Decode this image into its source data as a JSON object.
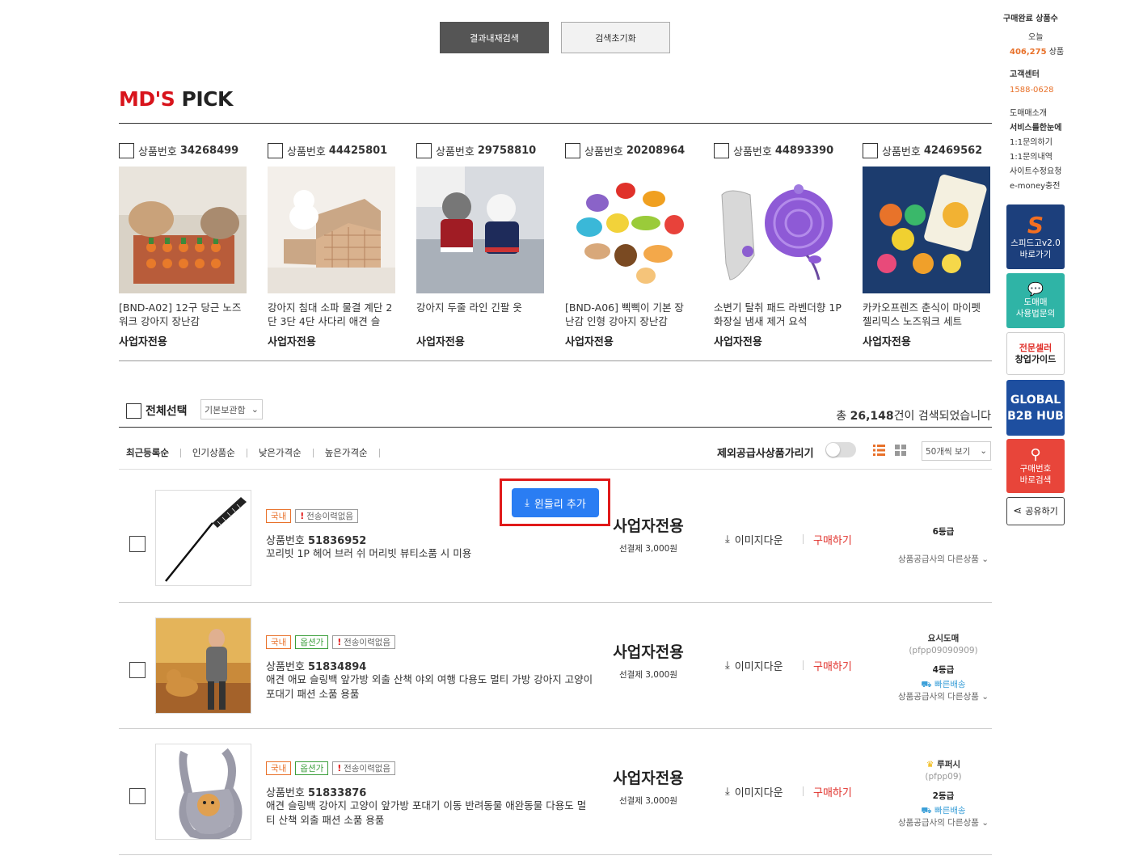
{
  "top_buttons": {
    "search_within": "결과내재검색",
    "reset_search": "검색초기화"
  },
  "md_pick": {
    "title_red": "MD'S",
    "title_black": "PICK",
    "items": [
      {
        "number_label": "상품번호",
        "number": "34268499",
        "name": "[BND-A02] 12구 당근 노즈워크 강아지 장난감",
        "tag": "사업자전용"
      },
      {
        "number_label": "상품번호",
        "number": "44425801",
        "name": "강아지 침대 소파 물결 계단 2단 3단 4단 사다리 애견 슬",
        "tag": "사업자전용"
      },
      {
        "number_label": "상품번호",
        "number": "29758810",
        "name": "강아지 두줄 라인 긴팔 옷",
        "tag": "사업자전용"
      },
      {
        "number_label": "상품번호",
        "number": "20208964",
        "name": "[BND-A06] 삑삑이 기본 장난감 인형 강아지 장난감",
        "tag": "사업자전용"
      },
      {
        "number_label": "상품번호",
        "number": "44893390",
        "name": "소변기 탈취 패드 라벤더향 1P 화장실 냄새 제거 요석",
        "tag": "사업자전용"
      },
      {
        "number_label": "상품번호",
        "number": "42469562",
        "name": "카카오프렌즈 춘식이 마이펫 젤리믹스 노즈워크 세트",
        "tag": "사업자전용"
      }
    ]
  },
  "list_header": {
    "select_all": "전체선택",
    "storage_select": "기본보관함",
    "total_prefix": "총",
    "total_count": "26,148",
    "total_suffix": "건이 검색되었습니다",
    "sort_options": [
      "최근등록순",
      "인기상품순",
      "낮은가격순",
      "높은가격순"
    ],
    "exclude_label": "제외공급사상품가리기",
    "per_page": "50개씩 보기"
  },
  "popup": {
    "label": "윈들리 추가"
  },
  "products": [
    {
      "tags": [
        {
          "text": "국내",
          "type": "orange"
        },
        {
          "text": "전송이력없음",
          "type": "red"
        }
      ],
      "number_label": "상품번호",
      "number": "51836952",
      "name": "꼬리빗 1P 헤어 브러 쉬 머리빗 뷰티소품 시 미용",
      "biz": "사업자전용",
      "shipping": "선결제 3,000원",
      "image_download": "이미지다운",
      "buy": "구매하기",
      "seller_name": "",
      "seller_id": "",
      "grade": "6등급",
      "fast": "",
      "other_products": "상품공급사의 다른상품"
    },
    {
      "tags": [
        {
          "text": "국내",
          "type": "orange"
        },
        {
          "text": "옵션가",
          "type": "green"
        },
        {
          "text": "전송이력없음",
          "type": "red"
        }
      ],
      "number_label": "상품번호",
      "number": "51834894",
      "name": "애견 애묘 슬링백 앞가방 외출 산책 야외 여행 다용도 멀티 가방 강아지 고양이 포대기 패션 소품 용품",
      "biz": "사업자전용",
      "shipping": "선결제 3,000원",
      "image_download": "이미지다운",
      "buy": "구매하기",
      "seller_name": "요시도매",
      "seller_id": "(pfpp09090909)",
      "grade": "4등급",
      "fast": "빠른배송",
      "other_products": "상품공급사의 다른상품"
    },
    {
      "tags": [
        {
          "text": "국내",
          "type": "orange"
        },
        {
          "text": "옵션가",
          "type": "green"
        },
        {
          "text": "전송이력없음",
          "type": "red"
        }
      ],
      "number_label": "상품번호",
      "number": "51833876",
      "name": "애견 슬링백 강아지 고양이 앞가방 포대기 이동 반려동물 애완동물 다용도 멀티 산책 외출 패션 소품 용품",
      "biz": "사업자전용",
      "shipping": "선결제 3,000원",
      "image_download": "이미지다운",
      "buy": "구매하기",
      "seller_name": "루퍼시",
      "seller_id": "(pfpp09)",
      "grade": "2등급",
      "fast": "빠른배송",
      "other_products": "상품공급사의 다른상품"
    }
  ],
  "sidebar": {
    "purchase_done": "구매완료 상품수",
    "today": "오늘",
    "today_count": "406,275",
    "today_unit": "상품",
    "customer_center": "고객센터",
    "phone": "1588-0628",
    "links": [
      "도매매소개",
      "서비스를한눈에",
      "1:1문의하기",
      "1:1문의내역",
      "사이트수정요청",
      "e-money충전"
    ],
    "speedgo_1": "스피드고v2.0",
    "speedgo_2": "바로가기",
    "guide_1": "도매매",
    "guide_2": "사용법문의",
    "seller_1": "전문셀러",
    "seller_2": "창업가이드",
    "global_1": "GLOBAL",
    "global_2": "B2B HUB",
    "search_1": "구매번호",
    "search_2": "바로검색",
    "share": "공유하기"
  }
}
